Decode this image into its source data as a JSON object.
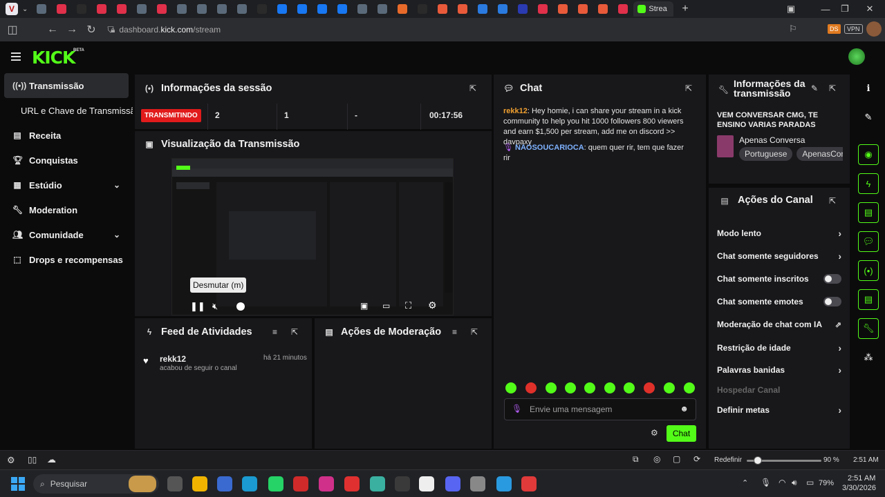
{
  "browser": {
    "active_tab_title": "Strea",
    "url_prefix": "dashboard.",
    "url_domain": "kick.com",
    "url_path": "/stream",
    "ds_badge": "DS",
    "vpn_badge": "VPN",
    "tab_colors": [
      "#5b6a7a",
      "#e0304a",
      "#2a2a2a",
      "#e0304a",
      "#e0304a",
      "#5b6a7a",
      "#e0304a",
      "#5b6a7a",
      "#5b6a7a",
      "#5b6a7a",
      "#5b6a7a",
      "#2a2a2a",
      "#1877f2",
      "#1877f2",
      "#1877f2",
      "#1877f2",
      "#5b6a7a",
      "#5b6a7a",
      "#e86a2a",
      "#2a2a2a",
      "#e85a3a",
      "#e85a3a",
      "#2a7ae0",
      "#2a7ae0",
      "#2a3ab0",
      "#e0304a",
      "#e85a3a",
      "#e85a3a",
      "#e85a3a",
      "#e0304a"
    ]
  },
  "app": {
    "logo": "KICK",
    "beta": "BETA",
    "accent": "#53fc18"
  },
  "sidebar": {
    "items": [
      {
        "label": "Transmissão",
        "icon": "broadcast-icon"
      },
      {
        "label": "URL e Chave de Transmissão",
        "icon": ""
      },
      {
        "label": "Receita",
        "icon": "revenue-icon"
      },
      {
        "label": "Conquistas",
        "icon": "trophy-icon"
      },
      {
        "label": "Estúdio",
        "icon": "studio-icon"
      },
      {
        "label": "Moderation",
        "icon": "wrench-icon"
      },
      {
        "label": "Comunidade",
        "icon": "community-icon"
      },
      {
        "label": "Drops e recompensas",
        "icon": "drops-icon"
      }
    ]
  },
  "session": {
    "title": "Informações da sessão",
    "status": "TRANSMITINDO",
    "stats": [
      "2",
      "1",
      "-",
      "00:17:56"
    ]
  },
  "preview": {
    "title": "Visualização da Transmissão",
    "tooltip": "Desmutar (m)"
  },
  "feed": {
    "title": "Feed de Atividades",
    "items": [
      {
        "user": "rekk12",
        "time": "há 21 minutos",
        "action": "acabou de seguir o canal"
      }
    ]
  },
  "mod_actions": {
    "title": "Ações de Moderação"
  },
  "chat": {
    "title": "Chat",
    "messages": [
      {
        "user": "rekk12",
        "text": ": Hey homie, i can share your stream in a kick community to help you hit 1000 followers 800 viewers and earn $1,500 per stream, add me on discord >> davpaxy"
      },
      {
        "user": "NAOSOUCARIOCA",
        "text": ": quem quer rir, tem que fazer rir"
      }
    ],
    "placeholder": "Envie uma mensagem",
    "send_label": "Chat"
  },
  "stream_info": {
    "title_line1": "Informações da",
    "title_line2": "transmissão",
    "stream_title": "VEM CONVERSAR CMG, TE ENSINO VARIAS PARADAS",
    "category": "Apenas Conversa",
    "tags": [
      "Portuguese",
      "ApenasConve"
    ]
  },
  "channel_actions": {
    "title": "Ações do Canal",
    "items": [
      {
        "label": "Modo lento",
        "control": "chevron"
      },
      {
        "label": "Chat somente seguidores",
        "control": "chevron"
      },
      {
        "label": "Chat somente inscritos",
        "control": "toggle"
      },
      {
        "label": "Chat somente emotes",
        "control": "toggle"
      },
      {
        "label": "Moderação de chat com IA",
        "control": "external"
      },
      {
        "label": "Restrição de idade",
        "control": "chevron"
      },
      {
        "label": "Palavras banidas",
        "control": "chevron"
      },
      {
        "label": "Hospedar Canal",
        "control": "disabled"
      },
      {
        "label": "Definir metas",
        "control": "chevron"
      }
    ]
  },
  "footer": {
    "reset_label": "Redefinir",
    "zoom": "90 %",
    "zoom_fraction": 0.15,
    "clock": "2:51 AM"
  },
  "taskbar": {
    "search_placeholder": "Pesquisar",
    "battery": "79%",
    "time": "2:51 AM",
    "date": "3/30/2026"
  }
}
